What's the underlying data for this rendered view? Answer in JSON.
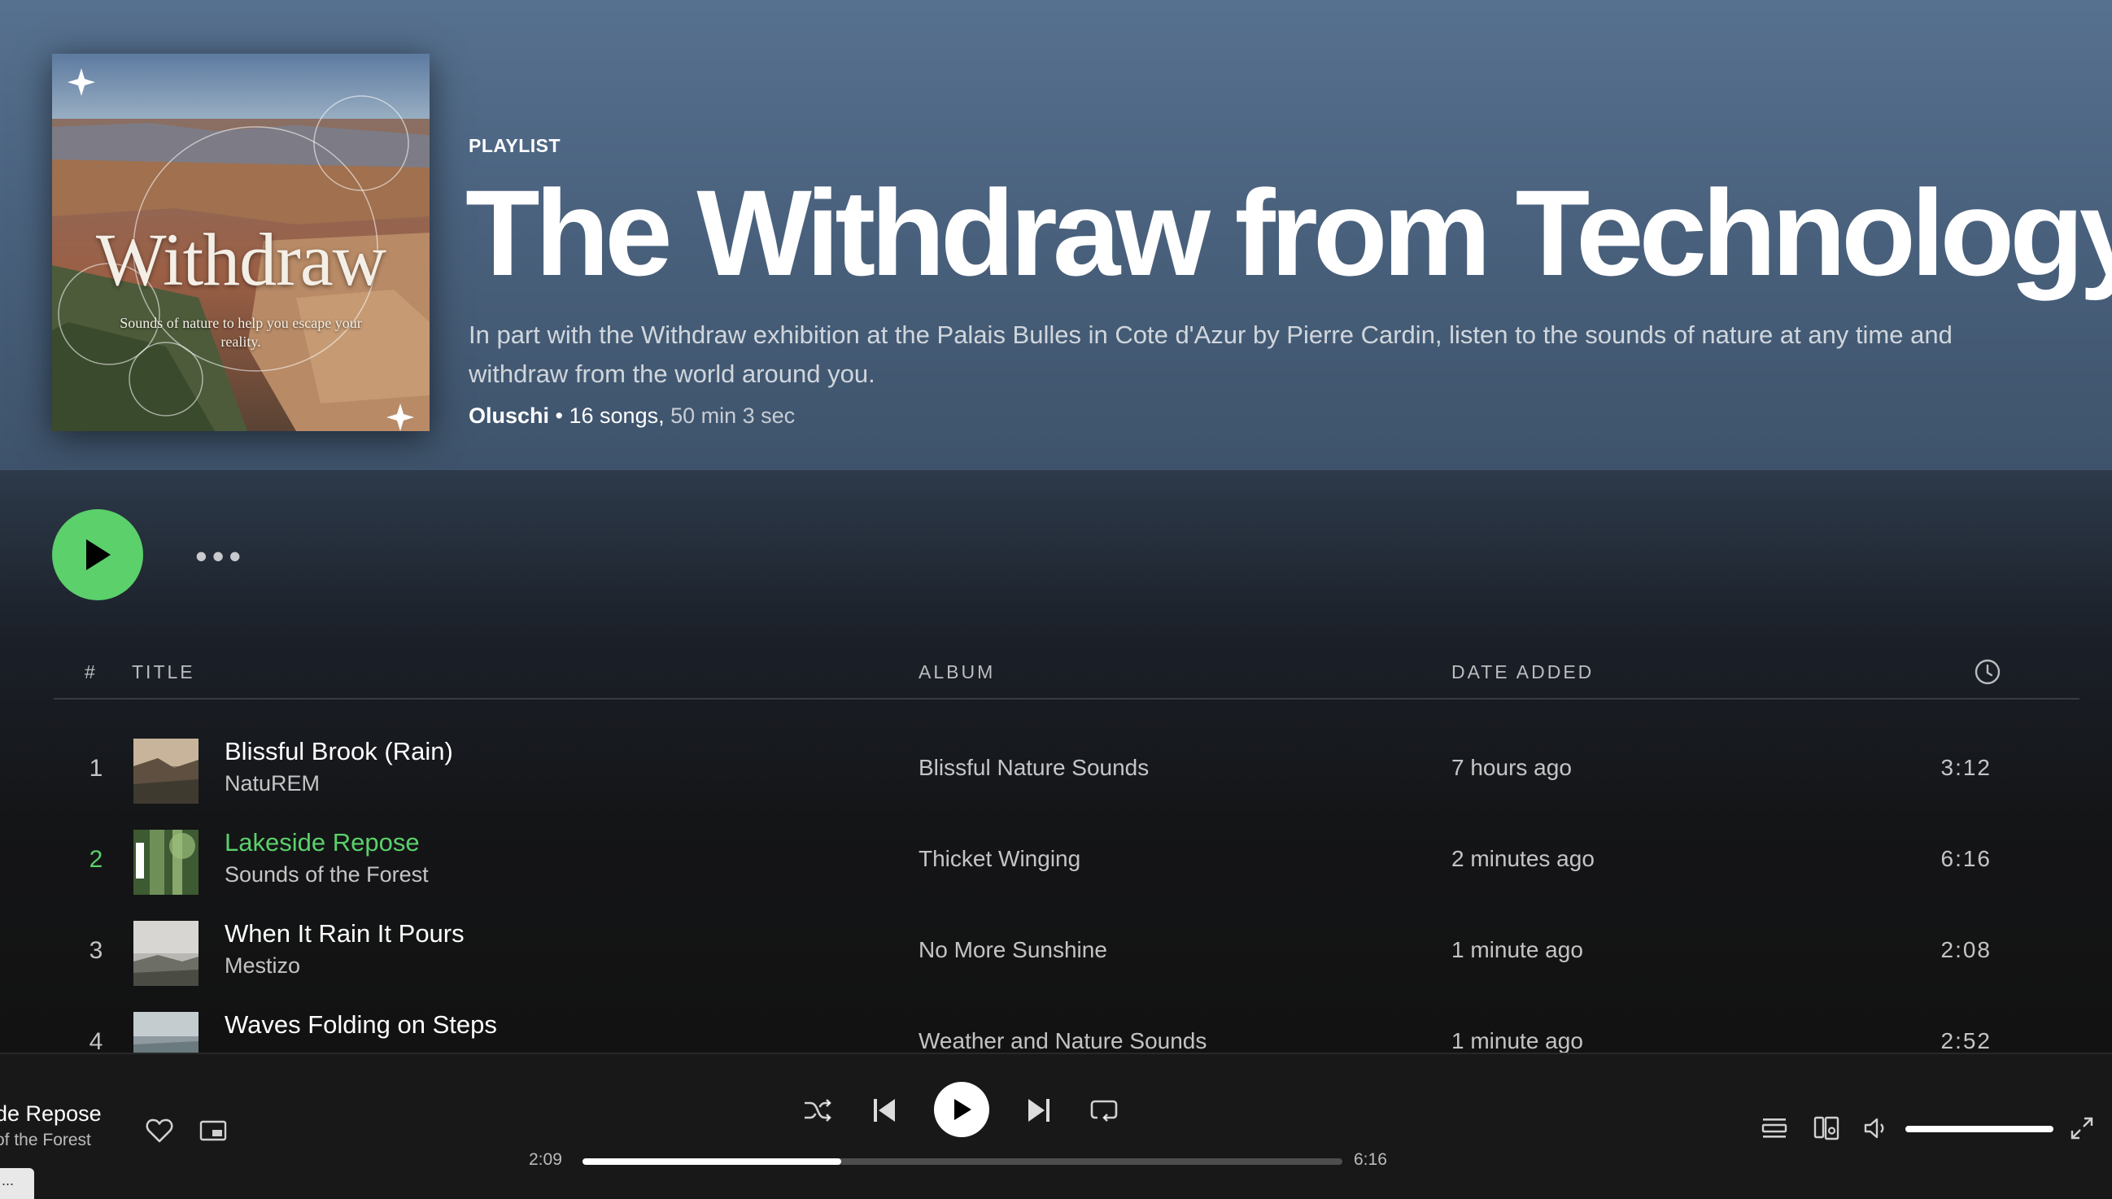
{
  "playlist": {
    "type_label": "PLAYLIST",
    "title": "The Withdraw from Technology",
    "description": "In part with the Withdraw exhibition at the Palais Bulles in Cote d'Azur by Pierre Cardin, listen to the sounds of nature at any time and withdraw from the world around you.",
    "owner": "Oluschi",
    "separator": " • ",
    "song_count": "16 songs,",
    "duration": " 50 min 3 sec",
    "cover": {
      "title": "Withdraw",
      "subtitle": "Sounds of nature to help you escape your reality."
    }
  },
  "actions": {
    "more_label": "•••"
  },
  "table": {
    "headers": {
      "index": "#",
      "title": "TITLE",
      "album": "ALBUM",
      "date_added": "DATE ADDED"
    },
    "rows": [
      {
        "index": "1",
        "title": "Blissful Brook (Rain)",
        "artist": "NatuREM",
        "album": "Blissful Nature Sounds",
        "date_added": "7 hours ago",
        "duration": "3:12"
      },
      {
        "index": "2",
        "title": "Lakeside Repose",
        "artist": "Sounds of the Forest",
        "album": "Thicket Winging",
        "date_added": "2 minutes ago",
        "duration": "6:16"
      },
      {
        "index": "3",
        "title": "When It Rain It Pours",
        "artist": "Mestizo",
        "album": "No More Sunshine",
        "date_added": "1 minute ago",
        "duration": "2:08"
      },
      {
        "index": "4",
        "title": "Waves Folding on Steps",
        "artist": "",
        "album": "Weather and Nature Sounds",
        "date_added": "1 minute ago",
        "duration": "2:52"
      }
    ]
  },
  "player": {
    "now_playing_title": "de Repose",
    "now_playing_artist": "of the Forest",
    "elapsed": "2:09",
    "total": "6:16",
    "progress_fraction": 0.34,
    "volume_fraction": 1.0,
    "tooltip": "..."
  },
  "colors": {
    "accent_green": "#5bd06b",
    "header_top": "#56718f",
    "background": "#121212"
  }
}
